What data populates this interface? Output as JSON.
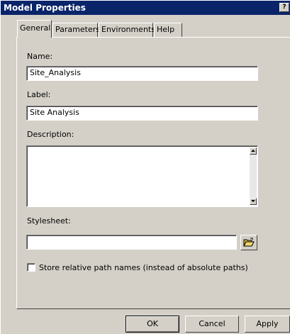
{
  "window": {
    "title": "Model Properties",
    "help_button": "?"
  },
  "tabs": [
    {
      "label": "General",
      "selected": true
    },
    {
      "label": "Parameters",
      "selected": false
    },
    {
      "label": "Environments",
      "selected": false
    },
    {
      "label": "Help",
      "selected": false
    }
  ],
  "general": {
    "name_label": "Name:",
    "name_value": "Site_Analysis",
    "label_label": "Label:",
    "label_value": "Site Analysis",
    "description_label": "Description:",
    "description_value": "",
    "stylesheet_label": "Stylesheet:",
    "stylesheet_value": "",
    "browse_icon": "open-folder-icon",
    "relative_paths_label": "Store relative path names (instead of absolute paths)",
    "relative_paths_checked": false
  },
  "buttons": {
    "ok": "OK",
    "cancel": "Cancel",
    "apply": "Apply"
  }
}
